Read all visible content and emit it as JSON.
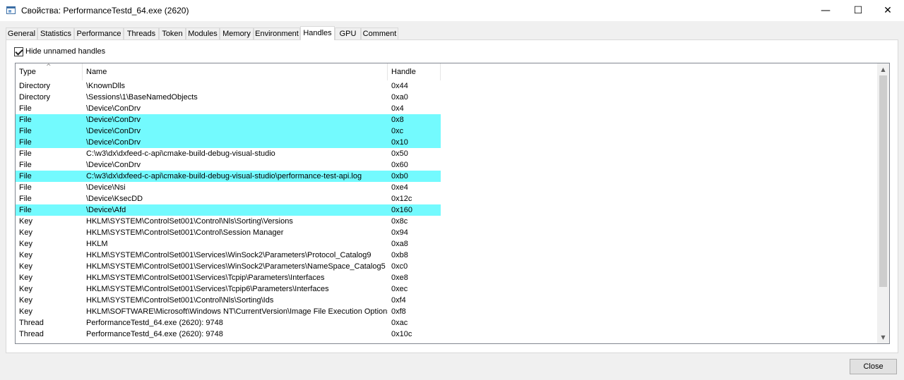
{
  "window": {
    "title": "Свойства: PerformanceTestd_64.exe (2620)",
    "minimize_glyph": "—",
    "maximize_glyph": "☐",
    "close_glyph": "✕"
  },
  "tabs": [
    {
      "label": "General"
    },
    {
      "label": "Statistics"
    },
    {
      "label": "Performance"
    },
    {
      "label": "Threads"
    },
    {
      "label": "Token"
    },
    {
      "label": "Modules"
    },
    {
      "label": "Memory"
    },
    {
      "label": "Environment"
    },
    {
      "label": "Handles",
      "active": true
    },
    {
      "label": "GPU"
    },
    {
      "label": "Comment"
    }
  ],
  "options": {
    "hide_unnamed_label": "Hide unnamed handles",
    "hide_unnamed_checked": true
  },
  "columns": {
    "type": "Type",
    "name": "Name",
    "handle": "Handle",
    "sort_glyph": "^"
  },
  "highlight_color": "#73fafe",
  "rows": [
    {
      "type": "Directory",
      "name": "\\KnownDlls",
      "handle": "0x44"
    },
    {
      "type": "Directory",
      "name": "\\Sessions\\1\\BaseNamedObjects",
      "handle": "0xa0"
    },
    {
      "type": "File",
      "name": "\\Device\\ConDrv",
      "handle": "0x4"
    },
    {
      "type": "File",
      "name": "\\Device\\ConDrv",
      "handle": "0x8",
      "highlighted": true
    },
    {
      "type": "File",
      "name": "\\Device\\ConDrv",
      "handle": "0xc",
      "highlighted": true
    },
    {
      "type": "File",
      "name": "\\Device\\ConDrv",
      "handle": "0x10",
      "highlighted": true
    },
    {
      "type": "File",
      "name": "C:\\w3\\dx\\dxfeed-c-api\\cmake-build-debug-visual-studio",
      "handle": "0x50"
    },
    {
      "type": "File",
      "name": "\\Device\\ConDrv",
      "handle": "0x60"
    },
    {
      "type": "File",
      "name": "C:\\w3\\dx\\dxfeed-c-api\\cmake-build-debug-visual-studio\\performance-test-api.log",
      "handle": "0xb0",
      "highlighted": true
    },
    {
      "type": "File",
      "name": "\\Device\\Nsi",
      "handle": "0xe4"
    },
    {
      "type": "File",
      "name": "\\Device\\KsecDD",
      "handle": "0x12c"
    },
    {
      "type": "File",
      "name": "\\Device\\Afd",
      "handle": "0x160",
      "highlighted": true
    },
    {
      "type": "Key",
      "name": "HKLM\\SYSTEM\\ControlSet001\\Control\\Nls\\Sorting\\Versions",
      "handle": "0x8c"
    },
    {
      "type": "Key",
      "name": "HKLM\\SYSTEM\\ControlSet001\\Control\\Session Manager",
      "handle": "0x94"
    },
    {
      "type": "Key",
      "name": "HKLM",
      "handle": "0xa8"
    },
    {
      "type": "Key",
      "name": "HKLM\\SYSTEM\\ControlSet001\\Services\\WinSock2\\Parameters\\Protocol_Catalog9",
      "handle": "0xb8"
    },
    {
      "type": "Key",
      "name": "HKLM\\SYSTEM\\ControlSet001\\Services\\WinSock2\\Parameters\\NameSpace_Catalog5",
      "handle": "0xc0"
    },
    {
      "type": "Key",
      "name": "HKLM\\SYSTEM\\ControlSet001\\Services\\Tcpip\\Parameters\\Interfaces",
      "handle": "0xe8"
    },
    {
      "type": "Key",
      "name": "HKLM\\SYSTEM\\ControlSet001\\Services\\Tcpip6\\Parameters\\Interfaces",
      "handle": "0xec"
    },
    {
      "type": "Key",
      "name": "HKLM\\SYSTEM\\ControlSet001\\Control\\Nls\\Sorting\\Ids",
      "handle": "0xf4"
    },
    {
      "type": "Key",
      "name": "HKLM\\SOFTWARE\\Microsoft\\Windows NT\\CurrentVersion\\Image File Execution Options",
      "handle": "0xf8"
    },
    {
      "type": "Thread",
      "name": "PerformanceTestd_64.exe (2620): 9748",
      "handle": "0xac"
    },
    {
      "type": "Thread",
      "name": "PerformanceTestd_64.exe (2620): 9748",
      "handle": "0x10c"
    }
  ],
  "scrollbar": {
    "up_glyph": "▲",
    "down_glyph": "▼"
  },
  "footer": {
    "close_label": "Close"
  }
}
